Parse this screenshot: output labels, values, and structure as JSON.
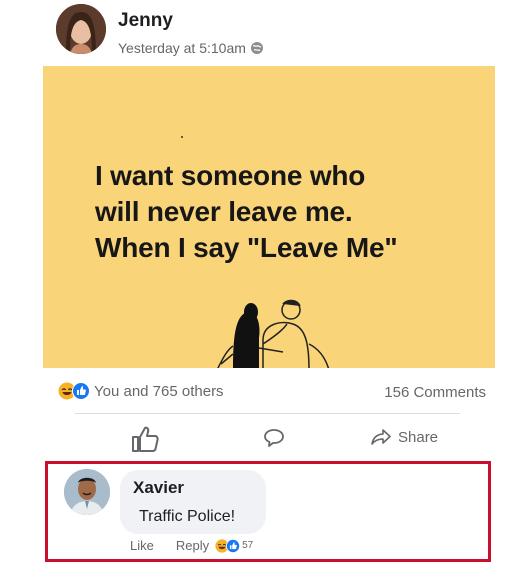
{
  "post": {
    "author": "Jenny",
    "timestamp": "Yesterday at 5:10am",
    "privacy_icon": "globe-icon",
    "image_text": "I want someone who\nwill never leave me.\nWhen I say \"Leave Me\""
  },
  "stats": {
    "reactions_text": "You and 765 others",
    "comments_text": "156 Comments",
    "reaction_icons": [
      "haha-icon",
      "like-icon"
    ]
  },
  "actions": {
    "like_icon": "thumbs-up-icon",
    "comment_icon": "comment-icon",
    "share_label": "Share"
  },
  "comment": {
    "author": "Xavier",
    "text": "Traffic Police!",
    "like_label": "Like",
    "reply_label": "Reply",
    "reaction_count": "57"
  },
  "colors": {
    "image_background": "#f9d479",
    "highlight_border": "#c8102e",
    "like_blue": "#1877f2",
    "haha_yellow": "#f7b125"
  }
}
